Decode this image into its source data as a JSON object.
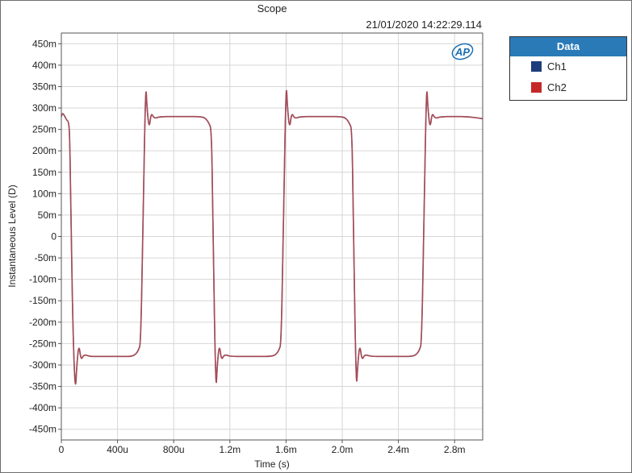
{
  "window": {
    "title": "Scope",
    "timestamp": "21/01/2020 14:22:29.114"
  },
  "logo": {
    "text": "AP"
  },
  "legend": {
    "title": "Data",
    "items": [
      {
        "label": "Ch1",
        "color": "#1f3d7a"
      },
      {
        "label": "Ch2",
        "color": "#c62828"
      }
    ]
  },
  "colors": {
    "trace": "#a64a55",
    "grid": "#d6d6d6",
    "logo": "#1a6fb5"
  },
  "chart_data": {
    "type": "line",
    "xlabel": "Time (s)",
    "ylabel": "Instantaneous Level (D)",
    "xlim": [
      0,
      0.003
    ],
    "ylim": [
      -0.475,
      0.475
    ],
    "grid": true,
    "legend_position": "outside-right",
    "x_ticks": [
      {
        "value": 0,
        "label": "0"
      },
      {
        "value": 0.0004,
        "label": "400u"
      },
      {
        "value": 0.0008,
        "label": "800u"
      },
      {
        "value": 0.0012,
        "label": "1.2m"
      },
      {
        "value": 0.0016,
        "label": "1.6m"
      },
      {
        "value": 0.002,
        "label": "2.0m"
      },
      {
        "value": 0.0024,
        "label": "2.4m"
      },
      {
        "value": 0.0028,
        "label": "2.8m"
      }
    ],
    "y_ticks": [
      {
        "value": 0.45,
        "label": "450m"
      },
      {
        "value": 0.4,
        "label": "400m"
      },
      {
        "value": 0.35,
        "label": "350m"
      },
      {
        "value": 0.3,
        "label": "300m"
      },
      {
        "value": 0.25,
        "label": "250m"
      },
      {
        "value": 0.2,
        "label": "200m"
      },
      {
        "value": 0.15,
        "label": "150m"
      },
      {
        "value": 0.1,
        "label": "100m"
      },
      {
        "value": 0.05,
        "label": "50m"
      },
      {
        "value": 0,
        "label": "0"
      },
      {
        "value": -0.05,
        "label": "-50m"
      },
      {
        "value": -0.1,
        "label": "-100m"
      },
      {
        "value": -0.15,
        "label": "-150m"
      },
      {
        "value": -0.2,
        "label": "-200m"
      },
      {
        "value": -0.25,
        "label": "-250m"
      },
      {
        "value": -0.3,
        "label": "-300m"
      },
      {
        "value": -0.35,
        "label": "-350m"
      },
      {
        "value": -0.4,
        "label": "-400m"
      },
      {
        "value": -0.45,
        "label": "-450m"
      }
    ],
    "series": [
      {
        "name": "Ch1",
        "color": "#1f3d7a",
        "x": [
          0,
          1e-05,
          4e-05,
          5e-05,
          6e-05,
          7e-05,
          8.5e-05,
          0.0001,
          0.00011,
          0.000125,
          0.00014,
          0.00016,
          0.0002,
          0.00025,
          0.0003,
          0.00035,
          0.0004,
          0.00045,
          0.0005,
          0.00053,
          0.00055,
          0.000565,
          0.00058,
          0.0006,
          0.00061,
          0.000625,
          0.00064,
          0.00066,
          0.0007,
          0.0008,
          0.0009,
          0.001,
          0.00103,
          0.00105,
          0.00107,
          0.00108,
          0.0011,
          0.00111,
          0.001125,
          0.00114,
          0.00116,
          0.0012,
          0.0013,
          0.0014,
          0.0015,
          0.00153,
          0.00155,
          0.001565,
          0.00158,
          0.0016,
          0.00161,
          0.001625,
          0.00164,
          0.00166,
          0.0017,
          0.0018,
          0.0019,
          0.002,
          0.00203,
          0.00205,
          0.00207,
          0.00208,
          0.0021,
          0.00211,
          0.002125,
          0.00214,
          0.00216,
          0.0022,
          0.0023,
          0.0024,
          0.0025,
          0.00253,
          0.00255,
          0.002565,
          0.00258,
          0.0026,
          0.00261,
          0.002625,
          0.00264,
          0.00266,
          0.0027,
          0.0028,
          0.0029,
          0.003
        ],
        "y": [
          0.28,
          0.29,
          0.27,
          0.27,
          0.24,
          0.0,
          -0.25,
          -0.365,
          -0.3,
          -0.25,
          -0.29,
          -0.275,
          -0.28,
          -0.28,
          -0.28,
          -0.28,
          -0.28,
          -0.28,
          -0.28,
          -0.275,
          -0.265,
          -0.25,
          0.0,
          0.365,
          0.3,
          0.25,
          0.29,
          0.275,
          0.28,
          0.28,
          0.28,
          0.28,
          0.275,
          0.265,
          0.25,
          0.0,
          -0.37,
          -0.3,
          -0.25,
          -0.29,
          -0.275,
          -0.28,
          -0.28,
          -0.28,
          -0.28,
          -0.275,
          -0.265,
          -0.25,
          0.0,
          0.37,
          0.3,
          0.25,
          0.29,
          0.275,
          0.28,
          0.28,
          0.28,
          0.28,
          0.275,
          0.265,
          0.25,
          0.0,
          -0.365,
          -0.3,
          -0.25,
          -0.29,
          -0.275,
          -0.28,
          -0.28,
          -0.28,
          -0.28,
          -0.275,
          -0.265,
          -0.25,
          0.0,
          0.365,
          0.3,
          0.25,
          0.29,
          0.275,
          0.28,
          0.28,
          0.28,
          0.275
        ]
      },
      {
        "name": "Ch2",
        "color": "#c62828",
        "x": [
          0,
          1e-05,
          4e-05,
          5e-05,
          6e-05,
          7e-05,
          8.5e-05,
          0.0001,
          0.00011,
          0.000125,
          0.00014,
          0.00016,
          0.0002,
          0.00025,
          0.0003,
          0.00035,
          0.0004,
          0.00045,
          0.0005,
          0.00053,
          0.00055,
          0.000565,
          0.00058,
          0.0006,
          0.00061,
          0.000625,
          0.00064,
          0.00066,
          0.0007,
          0.0008,
          0.0009,
          0.001,
          0.00103,
          0.00105,
          0.00107,
          0.00108,
          0.0011,
          0.00111,
          0.001125,
          0.00114,
          0.00116,
          0.0012,
          0.0013,
          0.0014,
          0.0015,
          0.00153,
          0.00155,
          0.001565,
          0.00158,
          0.0016,
          0.00161,
          0.001625,
          0.00164,
          0.00166,
          0.0017,
          0.0018,
          0.0019,
          0.002,
          0.00203,
          0.00205,
          0.00207,
          0.00208,
          0.0021,
          0.00211,
          0.002125,
          0.00214,
          0.00216,
          0.0022,
          0.0023,
          0.0024,
          0.0025,
          0.00253,
          0.00255,
          0.002565,
          0.00258,
          0.0026,
          0.00261,
          0.002625,
          0.00264,
          0.00266,
          0.0027,
          0.0028,
          0.0029,
          0.003
        ],
        "y": [
          0.28,
          0.29,
          0.27,
          0.27,
          0.24,
          0.0,
          -0.25,
          -0.365,
          -0.3,
          -0.25,
          -0.29,
          -0.275,
          -0.28,
          -0.28,
          -0.28,
          -0.28,
          -0.28,
          -0.28,
          -0.28,
          -0.275,
          -0.265,
          -0.25,
          0.0,
          0.365,
          0.3,
          0.25,
          0.29,
          0.275,
          0.28,
          0.28,
          0.28,
          0.28,
          0.275,
          0.265,
          0.25,
          0.0,
          -0.37,
          -0.3,
          -0.25,
          -0.29,
          -0.275,
          -0.28,
          -0.28,
          -0.28,
          -0.28,
          -0.275,
          -0.265,
          -0.25,
          0.0,
          0.37,
          0.3,
          0.25,
          0.29,
          0.275,
          0.28,
          0.28,
          0.28,
          0.28,
          0.275,
          0.265,
          0.25,
          0.0,
          -0.365,
          -0.3,
          -0.25,
          -0.29,
          -0.275,
          -0.28,
          -0.28,
          -0.28,
          -0.28,
          -0.275,
          -0.265,
          -0.25,
          0.0,
          0.365,
          0.3,
          0.25,
          0.29,
          0.275,
          0.28,
          0.28,
          0.28,
          0.275
        ]
      }
    ]
  }
}
